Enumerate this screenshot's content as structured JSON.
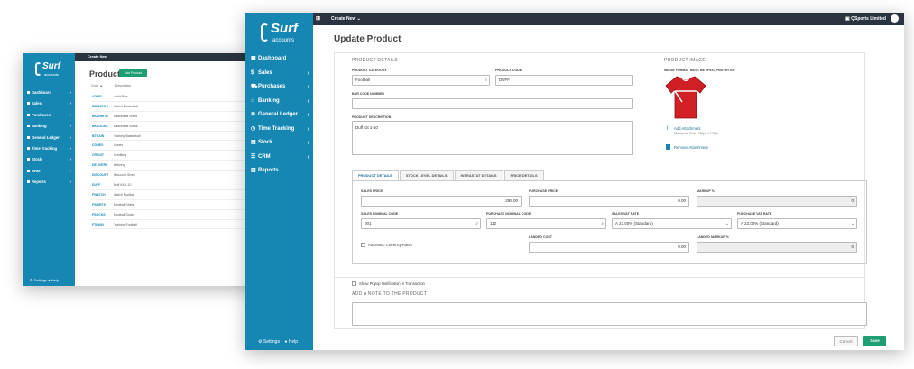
{
  "back": {
    "app": {
      "logo_main": "Surf",
      "logo_sub": "accounts",
      "menu": "Create New"
    },
    "nav": [
      "Dashboard",
      "Sales",
      "Purchases",
      "Banking",
      "General Ledger",
      "Time Tracking",
      "Stock",
      "CRM",
      "Reports"
    ],
    "footer": "⚙ Settings  ● Help",
    "title": "Products",
    "add_button": "Add Product",
    "table_headers": [
      "Code ▲",
      "Description"
    ],
    "rows": [
      {
        "code": "ADIBS",
        "desc": "Adult Bibs"
      },
      {
        "code": "BBWATCH",
        "desc": "Watch Basketball"
      },
      {
        "code": "BKSHIRTS",
        "desc": "Basketball Shirts"
      },
      {
        "code": "BKSOCKS",
        "desc": "Basketball Socks"
      },
      {
        "code": "BTRAIN",
        "desc": "Training Basketball"
      },
      {
        "code": "CONES",
        "desc": "Cones"
      },
      {
        "code": "CREDIT",
        "desc": "Crediting"
      },
      {
        "code": "DELIVERY",
        "desc": "Delivery"
      },
      {
        "code": "DISCOUNT",
        "desc": "Discount Given"
      },
      {
        "code": "DUFF",
        "desc": "Duff Kit 1-10"
      },
      {
        "code": "FWATCH",
        "desc": "Watch Football"
      },
      {
        "code": "FSHIRTS",
        "desc": "Football Shirts"
      },
      {
        "code": "FSOCKS",
        "desc": "Football Socks"
      },
      {
        "code": "FTRAIN",
        "desc": "Training Football"
      }
    ]
  },
  "front": {
    "app": {
      "logo_main": "Surf",
      "logo_sub": "accounts",
      "menu": "Create New",
      "company": "QSports Limited"
    },
    "nav": [
      {
        "label": "Dashboard",
        "chevron": false
      },
      {
        "label": "Sales",
        "chevron": true
      },
      {
        "label": "Purchases",
        "chevron": true
      },
      {
        "label": "Banking",
        "chevron": true
      },
      {
        "label": "General Ledger",
        "chevron": true
      },
      {
        "label": "Time Tracking",
        "chevron": true
      },
      {
        "label": "Stock",
        "chevron": true
      },
      {
        "label": "CRM",
        "chevron": true
      },
      {
        "label": "Reports",
        "chevron": false
      }
    ],
    "footer": {
      "settings": "Settings",
      "help": "Help"
    },
    "page_title": "Update Product",
    "product_details": {
      "section": "PRODUCT DETAILS",
      "category_label": "PRODUCT CATEGORY",
      "category_value": "Football",
      "code_label": "PRODUCT CODE",
      "code_value": "DUFF",
      "barcode_label": "BAR CODE NUMBER",
      "barcode_value": "",
      "desc_label": "PRODUCT DESCRIPTION",
      "desc_value": "Duff Kit 1-10"
    },
    "image": {
      "section": "PRODUCT IMAGE",
      "format_note": "IMAGE FORMAT MUST BE JPEG, PNG OR GIF",
      "add": "Add Attachment",
      "max_size": "Maximum Size : 256px * 128px",
      "remove": "Remove Attachment"
    },
    "tabs": [
      "PRODUCT DETAILS",
      "STOCK LEVEL DETAILS",
      "INTRASTAT DETAILS",
      "PRICE DETAILS"
    ],
    "pricing": {
      "sales_price_label": "SALES PRICE",
      "sales_price": "299.00",
      "purchase_price_label": "PURCHASE PRICE",
      "purchase_price": "0.00",
      "markup_label": "MARKUP %",
      "markup": "0",
      "sales_nominal_label": "SALES NOMINAL CODE",
      "sales_nominal": "001",
      "purchase_nominal_label": "PURCHASE NOMINAL CODE",
      "purchase_nominal": "112",
      "sales_vat_label": "SALES VAT RATE",
      "sales_vat": "A 23.00% (Standard)",
      "purchase_vat_label": "PURCHASE VAT RATE",
      "purchase_vat": "A 23.00% (Standard)",
      "auto_currency": "Automatic Currency Rates",
      "landed_cost_label": "LANDED COST",
      "landed_cost": "0.00",
      "landed_markup_label": "LANDED MARKUP %",
      "landed_markup": "0"
    },
    "popup_note": "Show Popup Notification in Transaction",
    "notes_section": "ADD A NOTE TO THE PRODUCT",
    "cancel": "Cancel",
    "save": "Save"
  }
}
